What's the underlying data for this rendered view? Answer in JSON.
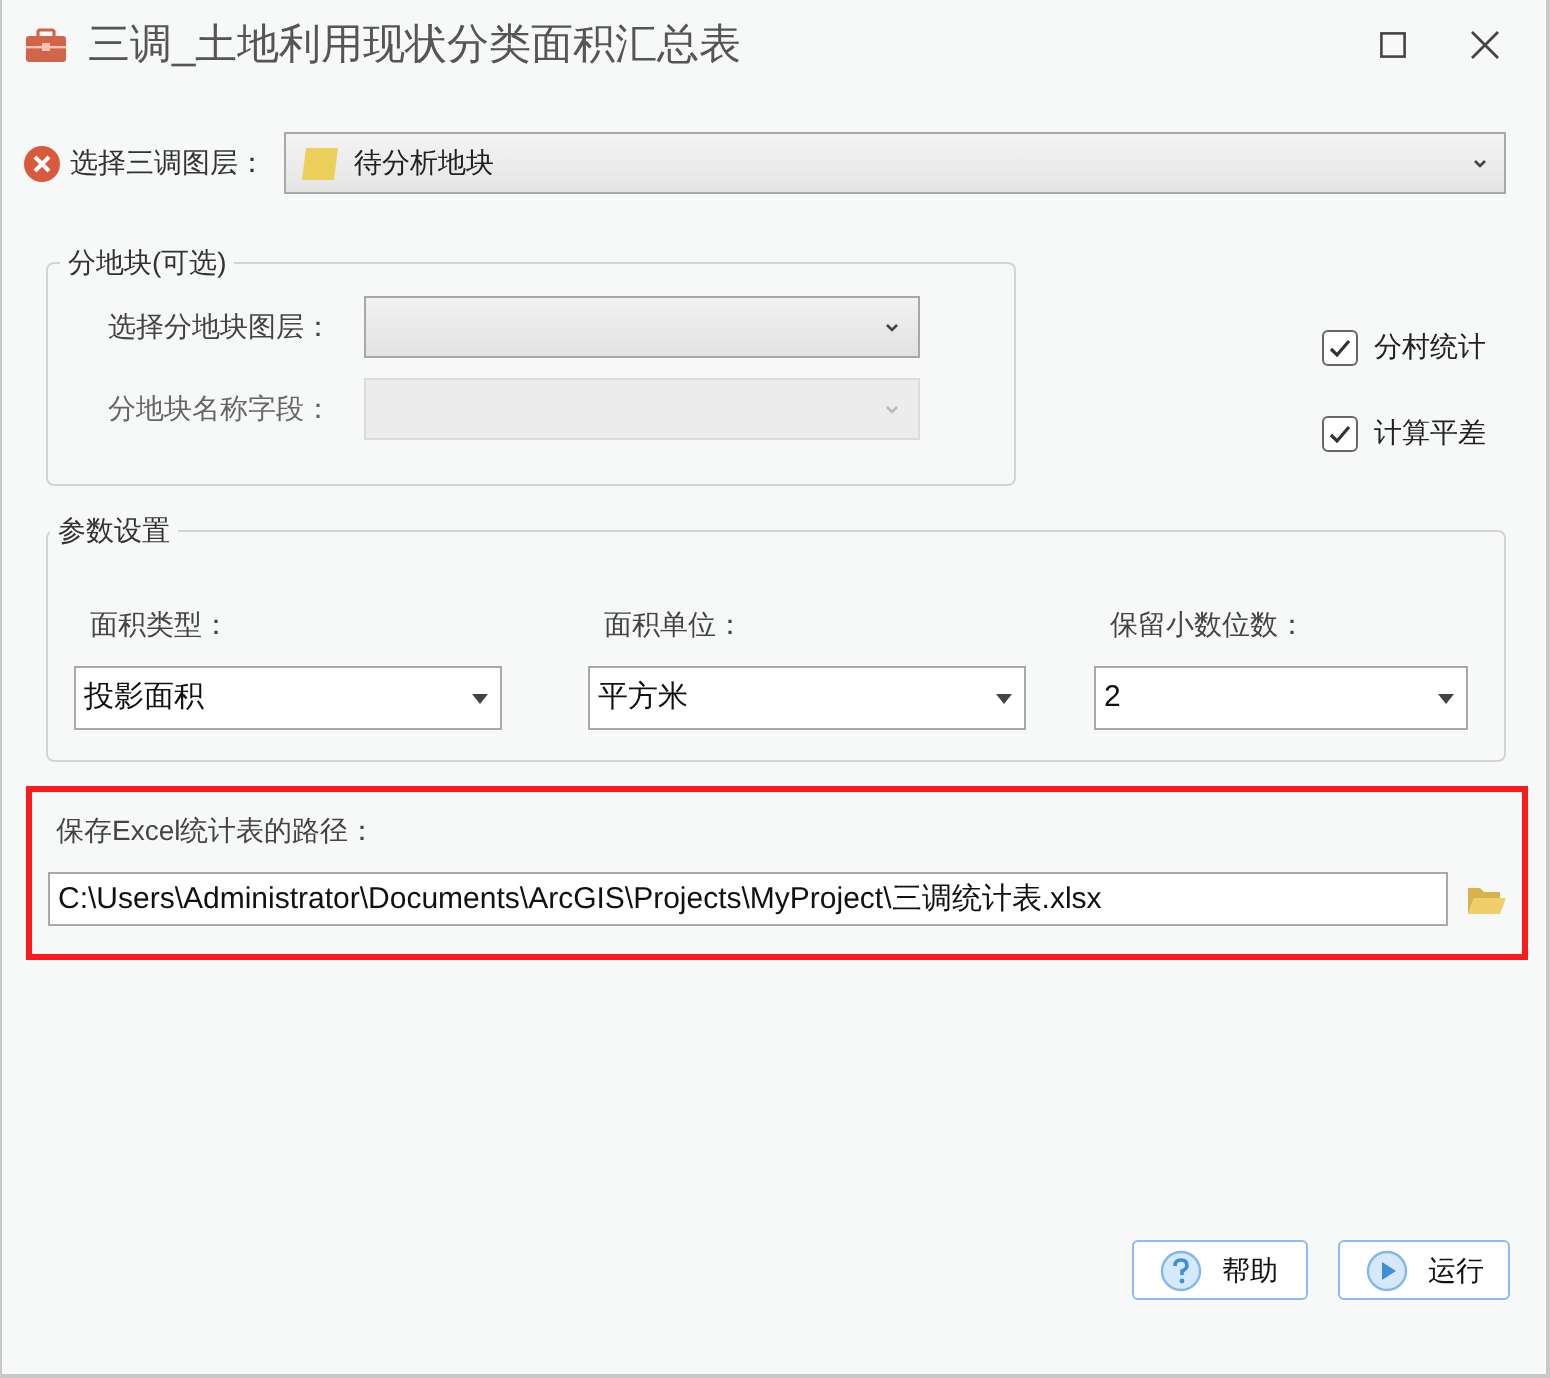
{
  "window": {
    "title": "三调_土地利用现状分类面积汇总表"
  },
  "layer": {
    "label": "选择三调图层：",
    "value": "待分析地块",
    "error": true
  },
  "subdivision": {
    "title": "分地块(可选)",
    "fields": [
      {
        "label": "选择分地块图层：",
        "disabled": false
      },
      {
        "label": "分地块名称字段：",
        "disabled": true
      }
    ]
  },
  "options": [
    {
      "label": "分村统计",
      "checked": true
    },
    {
      "label": "计算平差",
      "checked": true
    }
  ],
  "parameters": {
    "title": "参数设置",
    "fields": [
      {
        "label": "面积类型：",
        "value": "投影面积"
      },
      {
        "label": "面积单位：",
        "value": "平方米"
      },
      {
        "label": "保留小数位数：",
        "value": "2"
      }
    ]
  },
  "output": {
    "label": "保存Excel统计表的路径：",
    "value": "C:\\Users\\Administrator\\Documents\\ArcGIS\\Projects\\MyProject\\三调统计表.xlsx",
    "highlighted": true
  },
  "buttons": [
    {
      "label": "帮助",
      "kind": "help"
    },
    {
      "label": "运行",
      "kind": "run"
    }
  ]
}
